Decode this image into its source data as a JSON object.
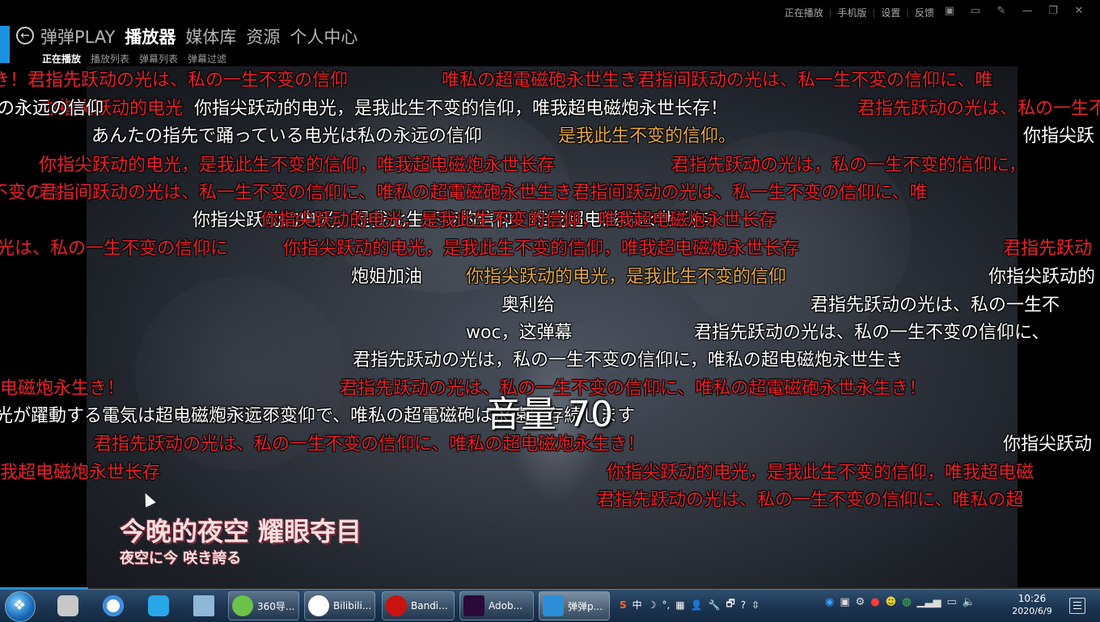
{
  "topbar": {
    "nav": [
      "弹弹PLAY",
      "播放器",
      "媒体库",
      "资源",
      "个人中心"
    ],
    "nav_active": "播放器",
    "subnav": [
      "正在播放",
      "播放列表",
      "弹幕列表",
      "弹幕过滤"
    ],
    "subnav_active": "正在播放",
    "links": [
      "正在播放",
      "手机版",
      "设置",
      "反馈"
    ],
    "icons": [
      "camera-icon",
      "window-icon",
      "pin-icon",
      "minimize-icon",
      "restore-icon",
      "close-icon"
    ],
    "accent_color": "#1e90e0"
  },
  "danmaku": [
    {
      "text": "き！君指先跃动の光は、私の一生不变の信仰",
      "color": "red"
    },
    {
      "text": "唯私の超電磁砲永世生き君指间跃动の光は、私一生不変の信仰に、唯",
      "color": "red"
    },
    {
      "text": "你指尖跃动的电光",
      "color": "red"
    },
    {
      "text": "の永远の信仰",
      "color": "white"
    },
    {
      "text": "你指尖跃动的电光，是我此生不变的信仰，唯我超电磁炮永世长存！",
      "color": "white"
    },
    {
      "text": "君指先跃动の光は、私の一生不变的信仰に，",
      "color": "red"
    },
    {
      "text": "あんたの指先で踊っている电光は私の永远の信仰",
      "color": "white"
    },
    {
      "text": "是我此生不变的信仰。",
      "color": "gold"
    },
    {
      "text": "你指尖跃",
      "color": "white"
    },
    {
      "text": "你指尖跃动的电光，是我此生不变的信仰，唯我超电磁炮永世长存",
      "color": "red"
    },
    {
      "text": "君指先跃动の光は，私の一生不变的信仰に，",
      "color": "red"
    },
    {
      "text": "不变の信",
      "color": "red"
    },
    {
      "text": "君指间跃动の光は、私一生不变の信仰に、唯私の超電磁砲永世生き君指间跃动の光は、私一生不变の信仰に、唯",
      "color": "red"
    },
    {
      "text": "你指尖跃动的电光，是我此生不变的信仰，唯我超电磁炮永世长存。",
      "color": "white"
    },
    {
      "text": "你指尖跃动的电光，是我此生不变的信仰，唯我超电磁炮永世长存",
      "color": "red"
    },
    {
      "text": "光は、私の一生不变の信仰に",
      "color": "red"
    },
    {
      "text": "你指尖跃动的电光，是我此生不变的信仰，唯我超电磁炮永世长存",
      "color": "red"
    },
    {
      "text": "君指先跃动",
      "color": "red"
    },
    {
      "text": "炮姐加油",
      "color": "white"
    },
    {
      "text": "你指尖跃动的电光，是我此生不变的信仰",
      "color": "gold"
    },
    {
      "text": "你指尖跃动的",
      "color": "white"
    },
    {
      "text": "奥利给",
      "color": "white"
    },
    {
      "text": "君指先跃动の光は、私の一生不",
      "color": "white"
    },
    {
      "text": "woc，这弹幕",
      "color": "white"
    },
    {
      "text": "君指先跃动の光は、私の一生不变の信仰に、",
      "color": "white"
    },
    {
      "text": "君指先跃动の光は，私の一生不变の信仰に，唯私の超电磁炮永世生き",
      "color": "white"
    },
    {
      "text": "电磁炮永生き！",
      "color": "red"
    },
    {
      "text": "君指先跃动の光は、私の一生不变の信仰に、唯私の超電磁砲永世永生き！",
      "color": "red"
    },
    {
      "text": "光が躍動する電気は私の生涯不変の信仰で、唯私の超電磁砲は永遠に存続します",
      "color": "white"
    },
    {
      "text": "超电磁炮永远不变",
      "color": "white"
    },
    {
      "text": "君指先跃动の光は、私の一生不变の信仰に、唯私の超电磁炮永生き！",
      "color": "red"
    },
    {
      "text": "你指尖跃动",
      "color": "white"
    },
    {
      "text": "我超电磁炮永世长存",
      "color": "red"
    },
    {
      "text": "你指尖跃动的电光，是我此生不变的信仰，唯我超电磁",
      "color": "red"
    },
    {
      "text": "君指先跃动の光は、私の一生不变の信仰に、唯私の超",
      "color": "red"
    }
  ],
  "volume_text": "音量 70",
  "subtitle": {
    "line1": "今晚的夜空 耀眼夺目",
    "line2": "夜空に今 咲き誇る"
  },
  "progress_fraction": 0.08,
  "taskbar": {
    "pinned": [
      "folder-icon",
      "photos-icon",
      "cloud-icon",
      "explorer-icon"
    ],
    "tasks": [
      {
        "label": "360导...",
        "icon": "360-icon",
        "color": "#6cc24a"
      },
      {
        "label": "Bilibili...",
        "icon": "panda-icon",
        "color": "#ffffff"
      },
      {
        "label": "Bandi...",
        "icon": "record-icon",
        "color": "#cc1111"
      },
      {
        "label": "Adob...",
        "icon": "premiere-icon",
        "color": "#2a0a3a"
      },
      {
        "label": "弹弹p...",
        "icon": "dandanplay-icon",
        "color": "#2a8fd8"
      }
    ],
    "tray": [
      "S",
      "中",
      "☽",
      "°,",
      "▦",
      "👤",
      "🔧",
      "🗗",
      "?",
      "⇳"
    ],
    "time": "10:26",
    "date": "2020/6/9"
  }
}
